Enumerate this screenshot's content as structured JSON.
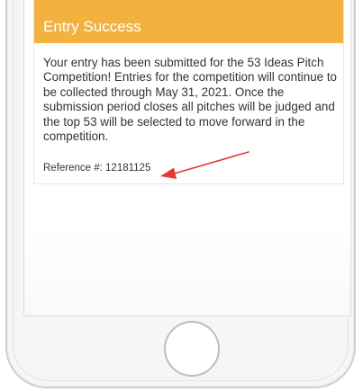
{
  "card": {
    "title": "Entry Success",
    "message": "Your entry has been submitted for the 53 Ideas Pitch Competition! Entries for the competition will continue to be collected through May 31, 2021. Once the submission period closes all pitches will be judged and the top 53 will be selected to move forward in the competition.",
    "reference": "Reference #: 12181125"
  },
  "colors": {
    "header_bg": "#f3b240",
    "header_text": "#ffffff",
    "arrow": "#e53935",
    "body_text": "#333333"
  },
  "icons": {
    "annotation": "red-arrow-icon",
    "home": "home-button-circle"
  }
}
